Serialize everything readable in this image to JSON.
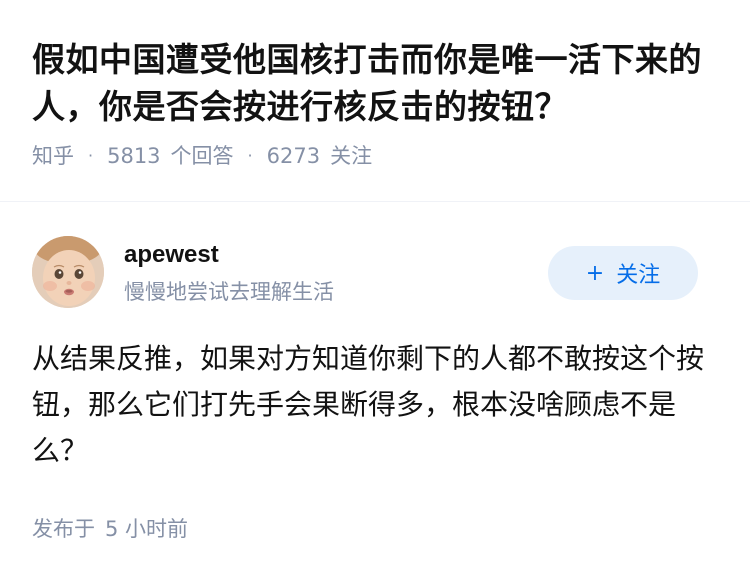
{
  "question": {
    "title": "假如中国遭受他国核打击而你是唯一活下来的人，你是否会按进行核反击的按钮？",
    "source": "知乎",
    "answer_count": "5813",
    "answer_label": "个回答",
    "follow_count": "6273",
    "follow_label": "关注"
  },
  "author": {
    "name": "apewest",
    "bio": "慢慢地尝试去理解生活",
    "follow_button_label": "关注",
    "follow_button_icon": "plus-icon"
  },
  "answer": {
    "content": "从结果反推，如果对方知道你剩下的人都不敢按这个按钮，那么它们打先手会果断得多，根本没啥顾虑不是么？"
  },
  "footer": {
    "publish_label": "发布于",
    "publish_time": "5 小时前"
  },
  "colors": {
    "accent": "#056de8",
    "button_bg": "#e6f0fb",
    "meta_text": "#8590a6",
    "title_text": "#121212"
  }
}
